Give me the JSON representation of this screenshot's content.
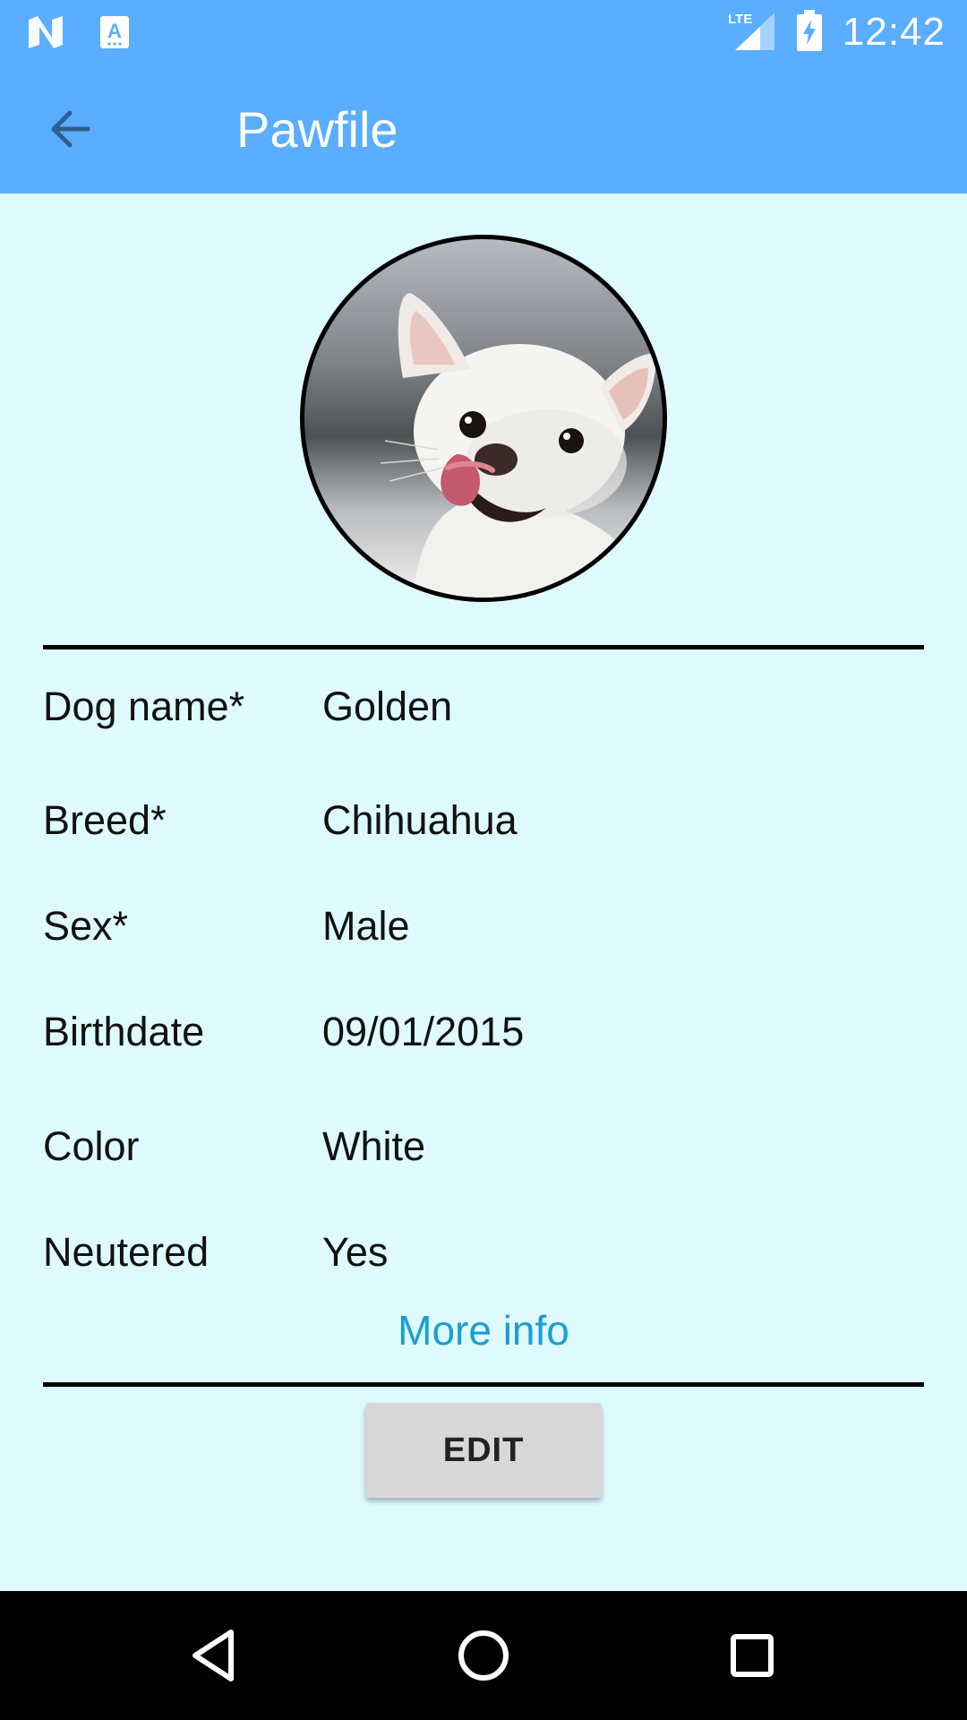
{
  "status_bar": {
    "time": "12:42",
    "network": "LTE",
    "icons": [
      "n-notification-icon",
      "text-notification-icon",
      "lte-signal-icon",
      "battery-charging-icon"
    ]
  },
  "app_bar": {
    "title": "Pawfile",
    "back_icon": "arrow-back-icon"
  },
  "profile": {
    "photo_icon": "dog-photo",
    "fields": [
      {
        "label": "Dog name*",
        "value": "Golden"
      },
      {
        "label": "Breed*",
        "value": "Chihuahua"
      },
      {
        "label": "Sex*",
        "value": "Male"
      },
      {
        "label": "Birthdate",
        "value": "09/01/2015"
      },
      {
        "label": "Color",
        "value": "White"
      },
      {
        "label": "Neutered",
        "value": "Yes"
      }
    ],
    "more_info_label": "More info"
  },
  "actions": {
    "edit_label": "EDIT"
  },
  "nav_bar": {
    "icons": [
      "nav-back-icon",
      "nav-home-icon",
      "nav-recents-icon"
    ]
  },
  "colors": {
    "app_bar": "#5aadff",
    "background": "#dffaff",
    "link": "#1a9fcf",
    "button": "#d8d8d8"
  }
}
